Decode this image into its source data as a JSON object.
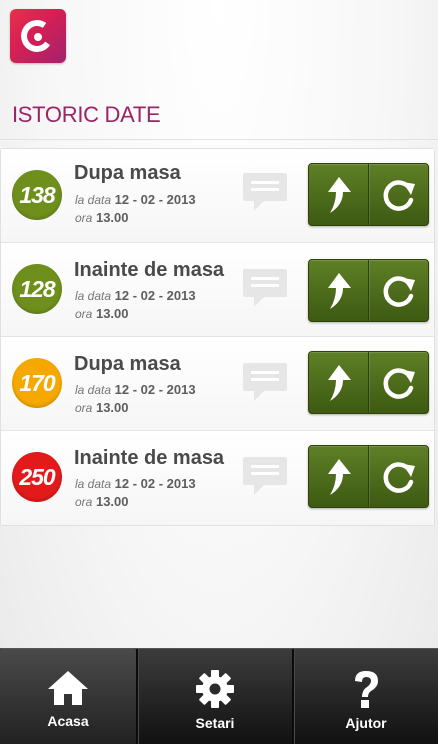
{
  "page": {
    "title": "ISTORIC DATE"
  },
  "labels": {
    "date_prefix": "la data",
    "time_prefix": "ora"
  },
  "colors": {
    "green": "#6f8f1d",
    "yellow": "#f5a800",
    "red": "#e21a1a",
    "accent": "#9b2468"
  },
  "records": [
    {
      "value": "138",
      "title": "Dupa masa",
      "date": "12 - 02 - 2013",
      "time": "13.00",
      "color": "#6f8f1d"
    },
    {
      "value": "128",
      "title": "Inainte de masa",
      "date": "12 - 02 - 2013",
      "time": "13.00",
      "color": "#6f8f1d"
    },
    {
      "value": "170",
      "title": "Dupa masa",
      "date": "12 - 02 - 2013",
      "time": "13.00",
      "color": "#f5a800"
    },
    {
      "value": "250",
      "title": "Inainte de masa",
      "date": "12 - 02 - 2013",
      "time": "13.00",
      "color": "#e21a1a"
    }
  ],
  "nav": [
    {
      "label": "Acasa",
      "icon": "home-icon"
    },
    {
      "label": "Setari",
      "icon": "gear-icon"
    },
    {
      "label": "Ajutor",
      "icon": "question-icon"
    }
  ]
}
